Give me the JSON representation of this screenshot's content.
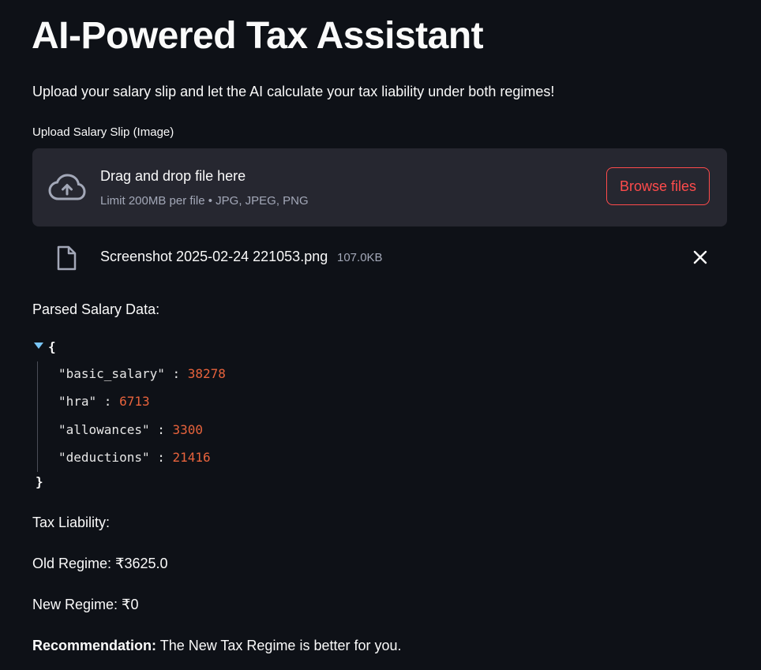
{
  "header": {
    "title": "AI-Powered Tax Assistant",
    "subtitle": "Upload your salary slip and let the AI calculate your tax liability under both regimes!"
  },
  "uploader": {
    "label": "Upload Salary Slip (Image)",
    "drop_title": "Drag and drop file here",
    "limit_text": "Limit 200MB per file • JPG, JPEG, PNG",
    "browse_label": "Browse files",
    "icon": "cloud-upload-icon"
  },
  "uploaded_file": {
    "name": "Screenshot 2025-02-24 221053.png",
    "size": "107.0KB",
    "icon": "file-icon",
    "remove_icon": "close-icon"
  },
  "parsed": {
    "label": "Parsed Salary Data:",
    "open_brace": "{",
    "close_brace": "}",
    "fields": [
      {
        "key": "\"basic_salary\"",
        "value": "38278"
      },
      {
        "key": "\"hra\"",
        "value": "6713"
      },
      {
        "key": "\"allowances\"",
        "value": "3300"
      },
      {
        "key": "\"deductions\"",
        "value": "21416"
      }
    ]
  },
  "tax": {
    "label": "Tax Liability:",
    "old_regime": "Old Regime: ₹3625.0",
    "new_regime": "New Regime: ₹0",
    "recommendation_label": "Recommendation:",
    "recommendation_text": " The New Tax Regime is better for you."
  },
  "colors": {
    "background": "#0e1117",
    "panel": "#262730",
    "accent": "#ff4b4b",
    "json_number": "#e8633c",
    "json_caret": "#79c5f5"
  }
}
